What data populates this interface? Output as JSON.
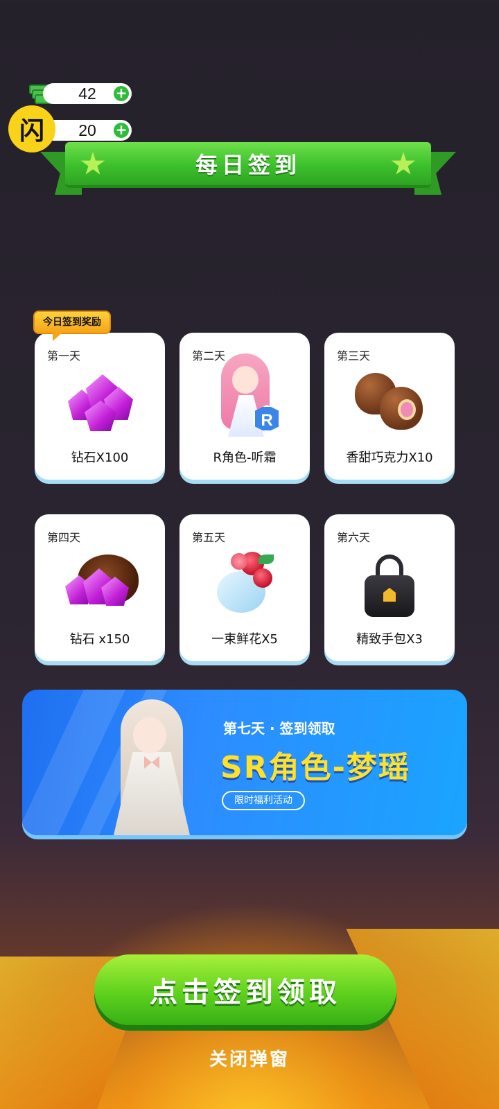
{
  "currency": {
    "cash": "42",
    "energy": "20",
    "logo_glyph": "闪"
  },
  "banner": {
    "title": "每日签到"
  },
  "today_tag": "今日签到奖励",
  "days": [
    {
      "day": "第一天",
      "reward": "钻石X100",
      "icon": "diamond-icon"
    },
    {
      "day": "第二天",
      "reward": "R角色-听霜",
      "icon": "character-icon",
      "rarity": "R"
    },
    {
      "day": "第三天",
      "reward": "香甜巧克力X10",
      "icon": "chocolate-icon"
    },
    {
      "day": "第四天",
      "reward": "钻石 x150",
      "icon": "diamond-bag-icon"
    },
    {
      "day": "第五天",
      "reward": "一束鲜花X5",
      "icon": "bouquet-icon"
    },
    {
      "day": "第六天",
      "reward": "精致手包X3",
      "icon": "handbag-icon"
    }
  ],
  "day7": {
    "subtitle": "第七天 · 签到领取",
    "title": "SR角色-梦瑶",
    "tag": "限时福利活动"
  },
  "actions": {
    "claim": "点击签到领取",
    "close": "关闭弹窗"
  },
  "colors": {
    "accent_green": "#3cc02c",
    "accent_blue": "#2d8cff",
    "accent_yellow": "#ffe12a",
    "background": "#25212b"
  }
}
